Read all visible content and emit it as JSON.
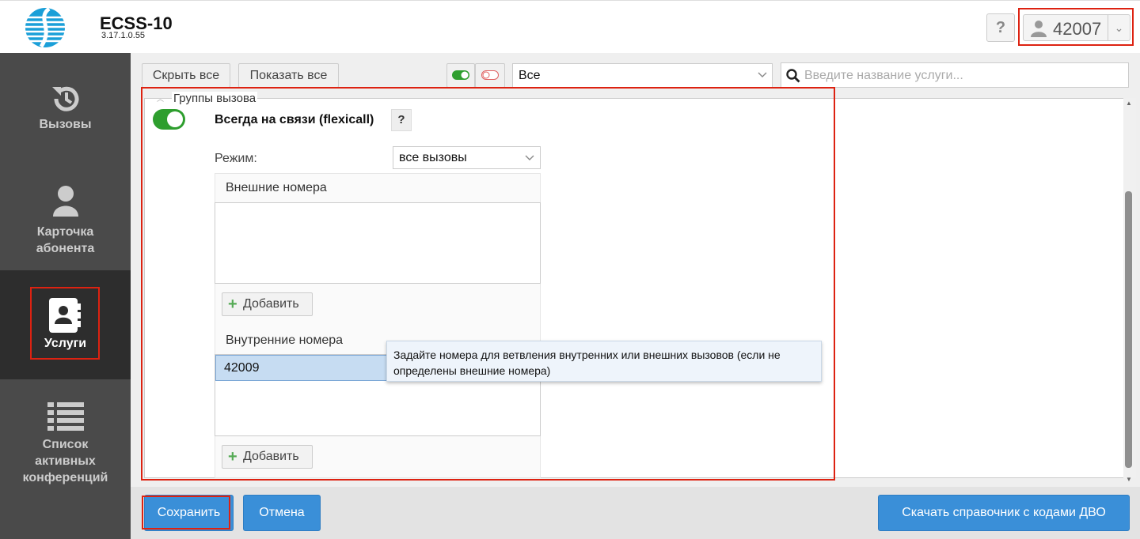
{
  "app": {
    "title": "ECSS-10",
    "version": "3.17.1.0.55"
  },
  "header": {
    "help_label": "?",
    "user_number": "42007",
    "user_dropdown_glyph": "⌄"
  },
  "sidebar": {
    "items": [
      {
        "label": "Вызовы",
        "icon": "history-icon"
      },
      {
        "label": "Карточка абонента",
        "icon": "user-icon"
      },
      {
        "label": "Услуги",
        "icon": "contacts-book-icon"
      },
      {
        "label": "Список активных конференций",
        "icon": "list-icon"
      }
    ]
  },
  "toolbar": {
    "hide_all": "Скрыть все",
    "show_all": "Показать все",
    "filter_value": "Все",
    "search_placeholder": "Введите название услуги..."
  },
  "group": {
    "legend": "Группы вызова",
    "service_title": "Всегда на связи (flexicall)",
    "help": "?",
    "mode_label": "Режим:",
    "mode_value": "все вызовы",
    "external_title": "Внешние номера",
    "internal_title": "Внутренние номера",
    "internal_numbers": [
      "42009"
    ],
    "add_label": "Добавить",
    "tooltip": "Задайте номера для ветвления внутренних или внешних вызовов (если не определены внешние номера)"
  },
  "footer": {
    "save": "Сохранить",
    "cancel": "Отмена",
    "download": "Скачать справочник с кодами ДВО"
  },
  "colors": {
    "accent": "#3a8fd8",
    "highlight": "#d21f1f",
    "toggle_on": "#2e9e2e",
    "selected_row": "#c6dcf2"
  }
}
